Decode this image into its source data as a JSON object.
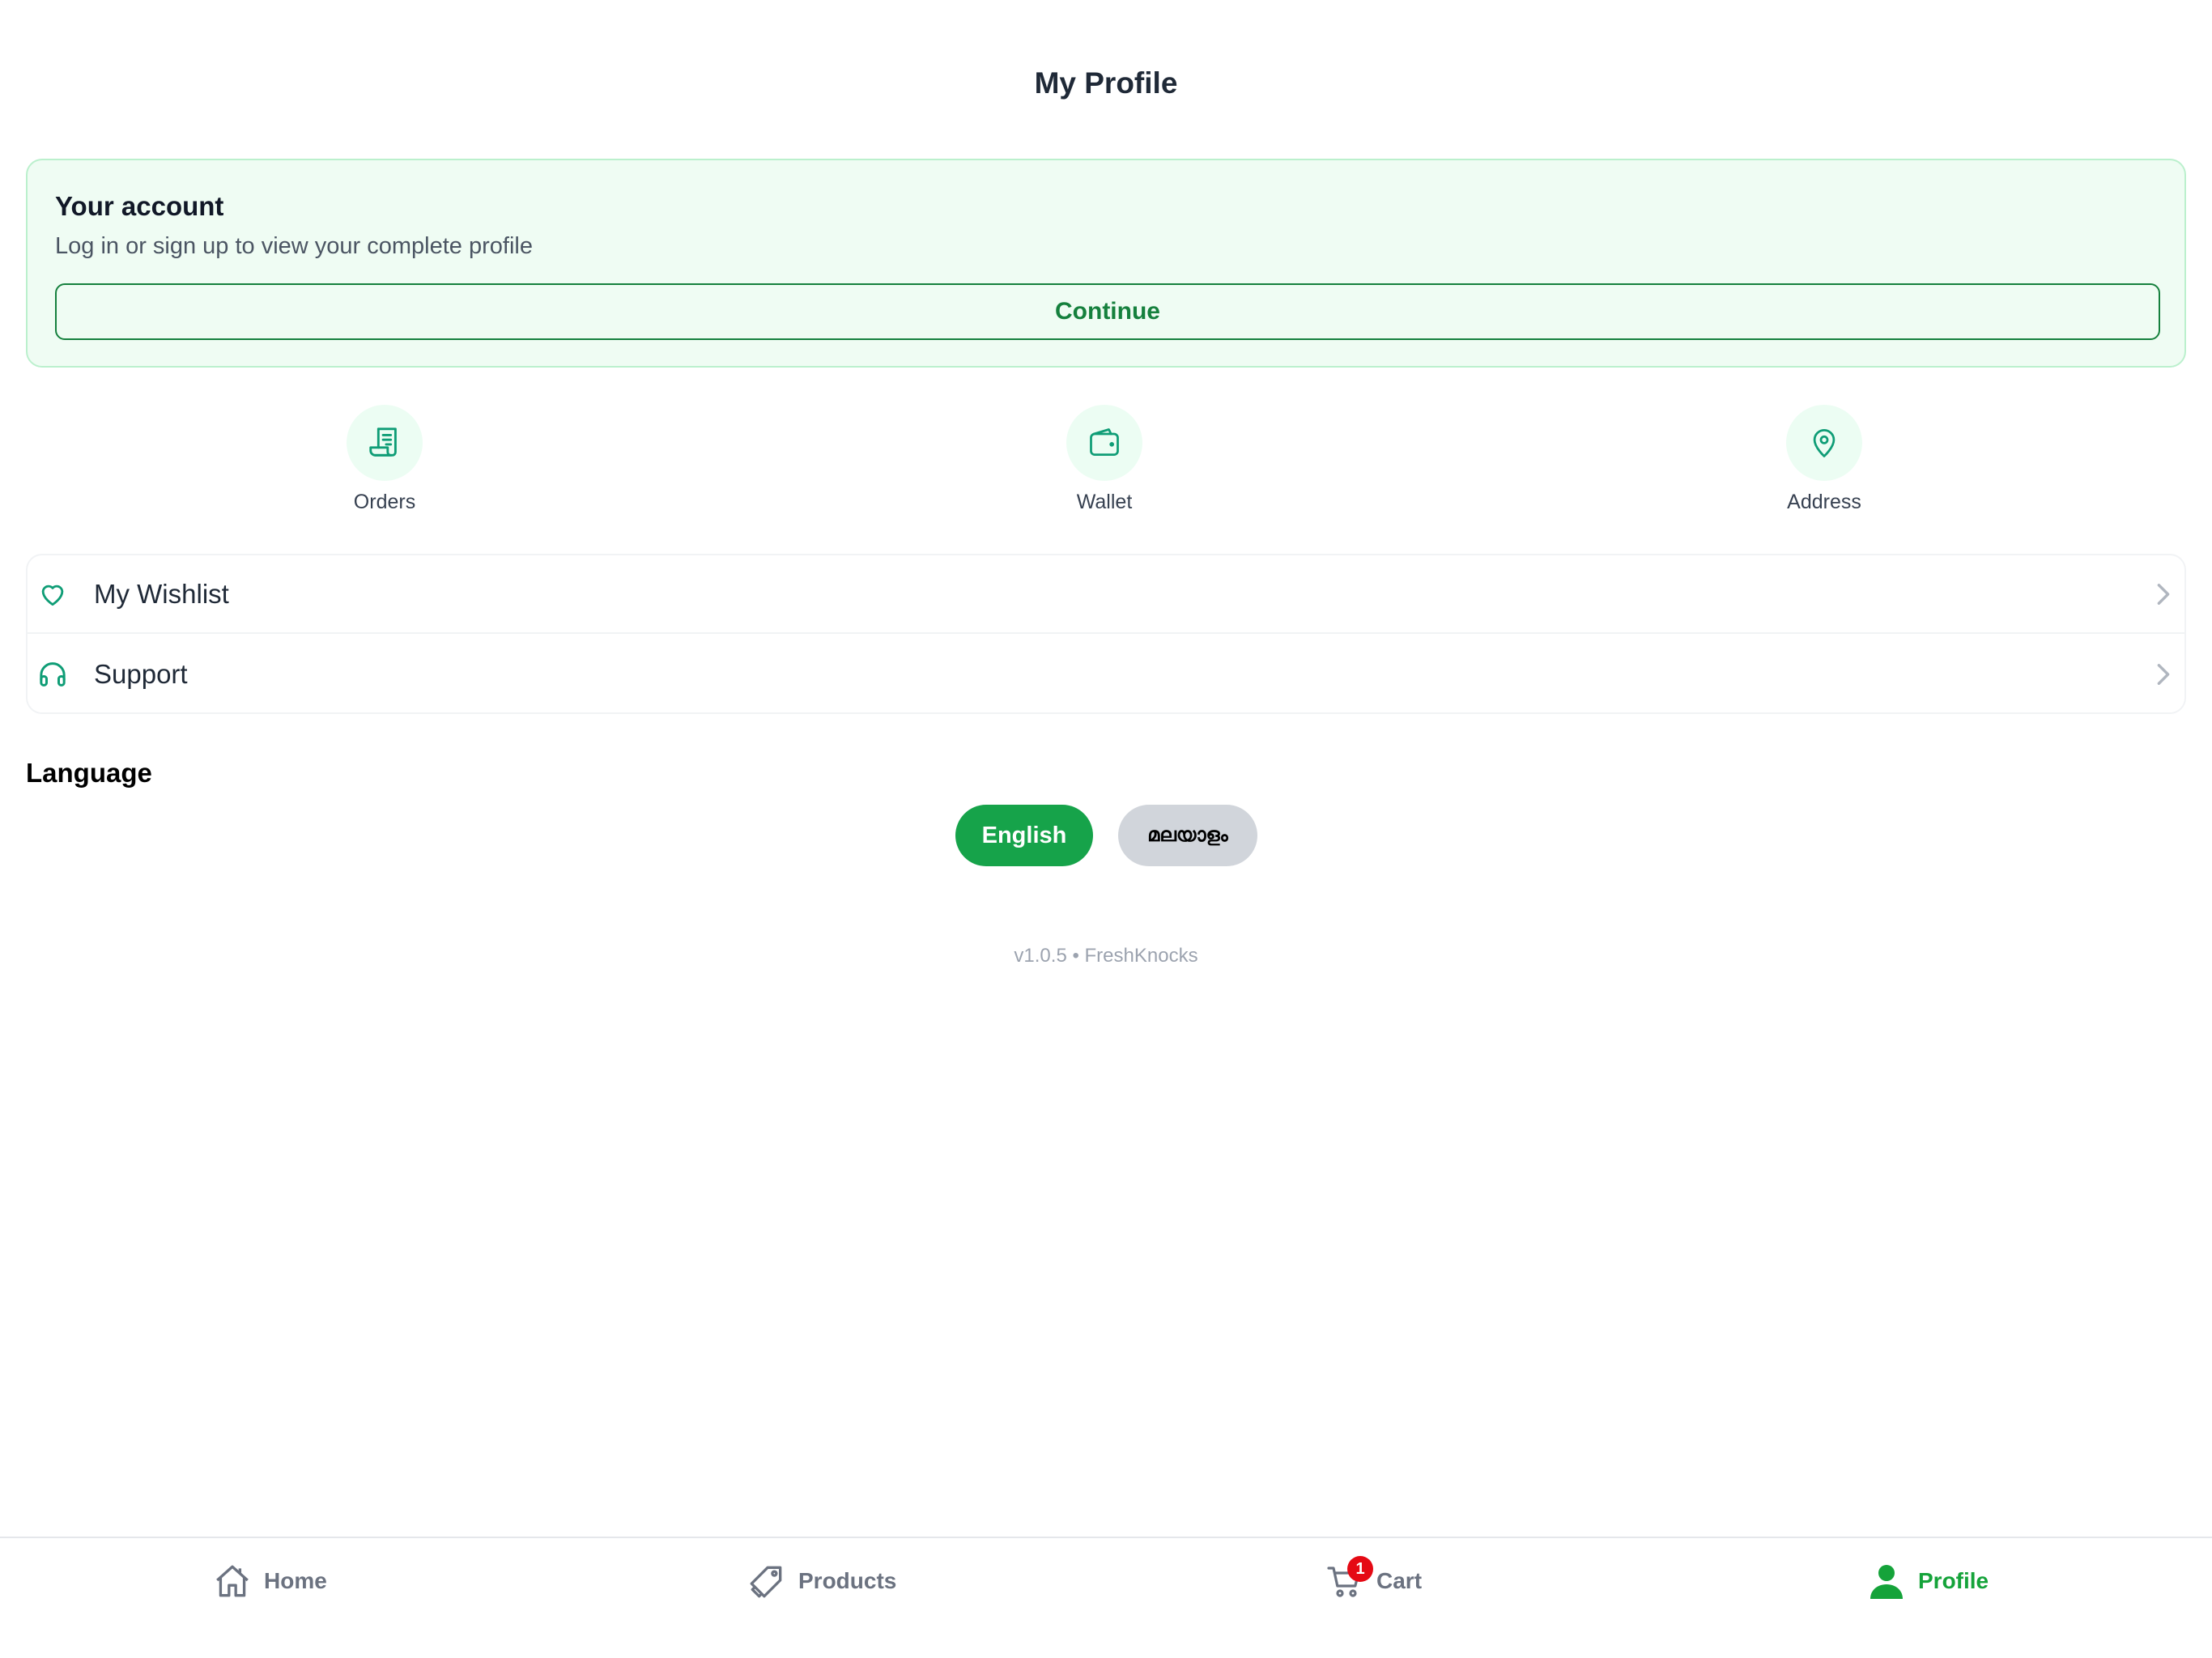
{
  "header": {
    "title": "My Profile"
  },
  "account": {
    "title": "Your account",
    "subtitle": "Log in or sign up to view your complete profile",
    "continue_label": "Continue"
  },
  "quick_actions": [
    {
      "label": "Orders",
      "icon": "receipt-icon"
    },
    {
      "label": "Wallet",
      "icon": "wallet-icon"
    },
    {
      "label": "Address",
      "icon": "location-pin-icon"
    }
  ],
  "menu": [
    {
      "label": "My Wishlist",
      "icon": "heart-icon"
    },
    {
      "label": "Support",
      "icon": "headphones-icon"
    }
  ],
  "language": {
    "title": "Language",
    "options": [
      "English",
      "മലയാളം"
    ],
    "selected": "English"
  },
  "footer": {
    "version": "v1.0.5 • FreshKnocks"
  },
  "tabs": [
    {
      "label": "Home",
      "icon": "home-icon"
    },
    {
      "label": "Products",
      "icon": "tag-icon"
    },
    {
      "label": "Cart",
      "icon": "cart-icon",
      "badge": "1"
    },
    {
      "label": "Profile",
      "icon": "user-icon",
      "active": true
    }
  ],
  "colors": {
    "accent": "#16a34a",
    "accent_dark": "#15803d",
    "card_bg": "#effcf3",
    "badge": "#e50914"
  }
}
